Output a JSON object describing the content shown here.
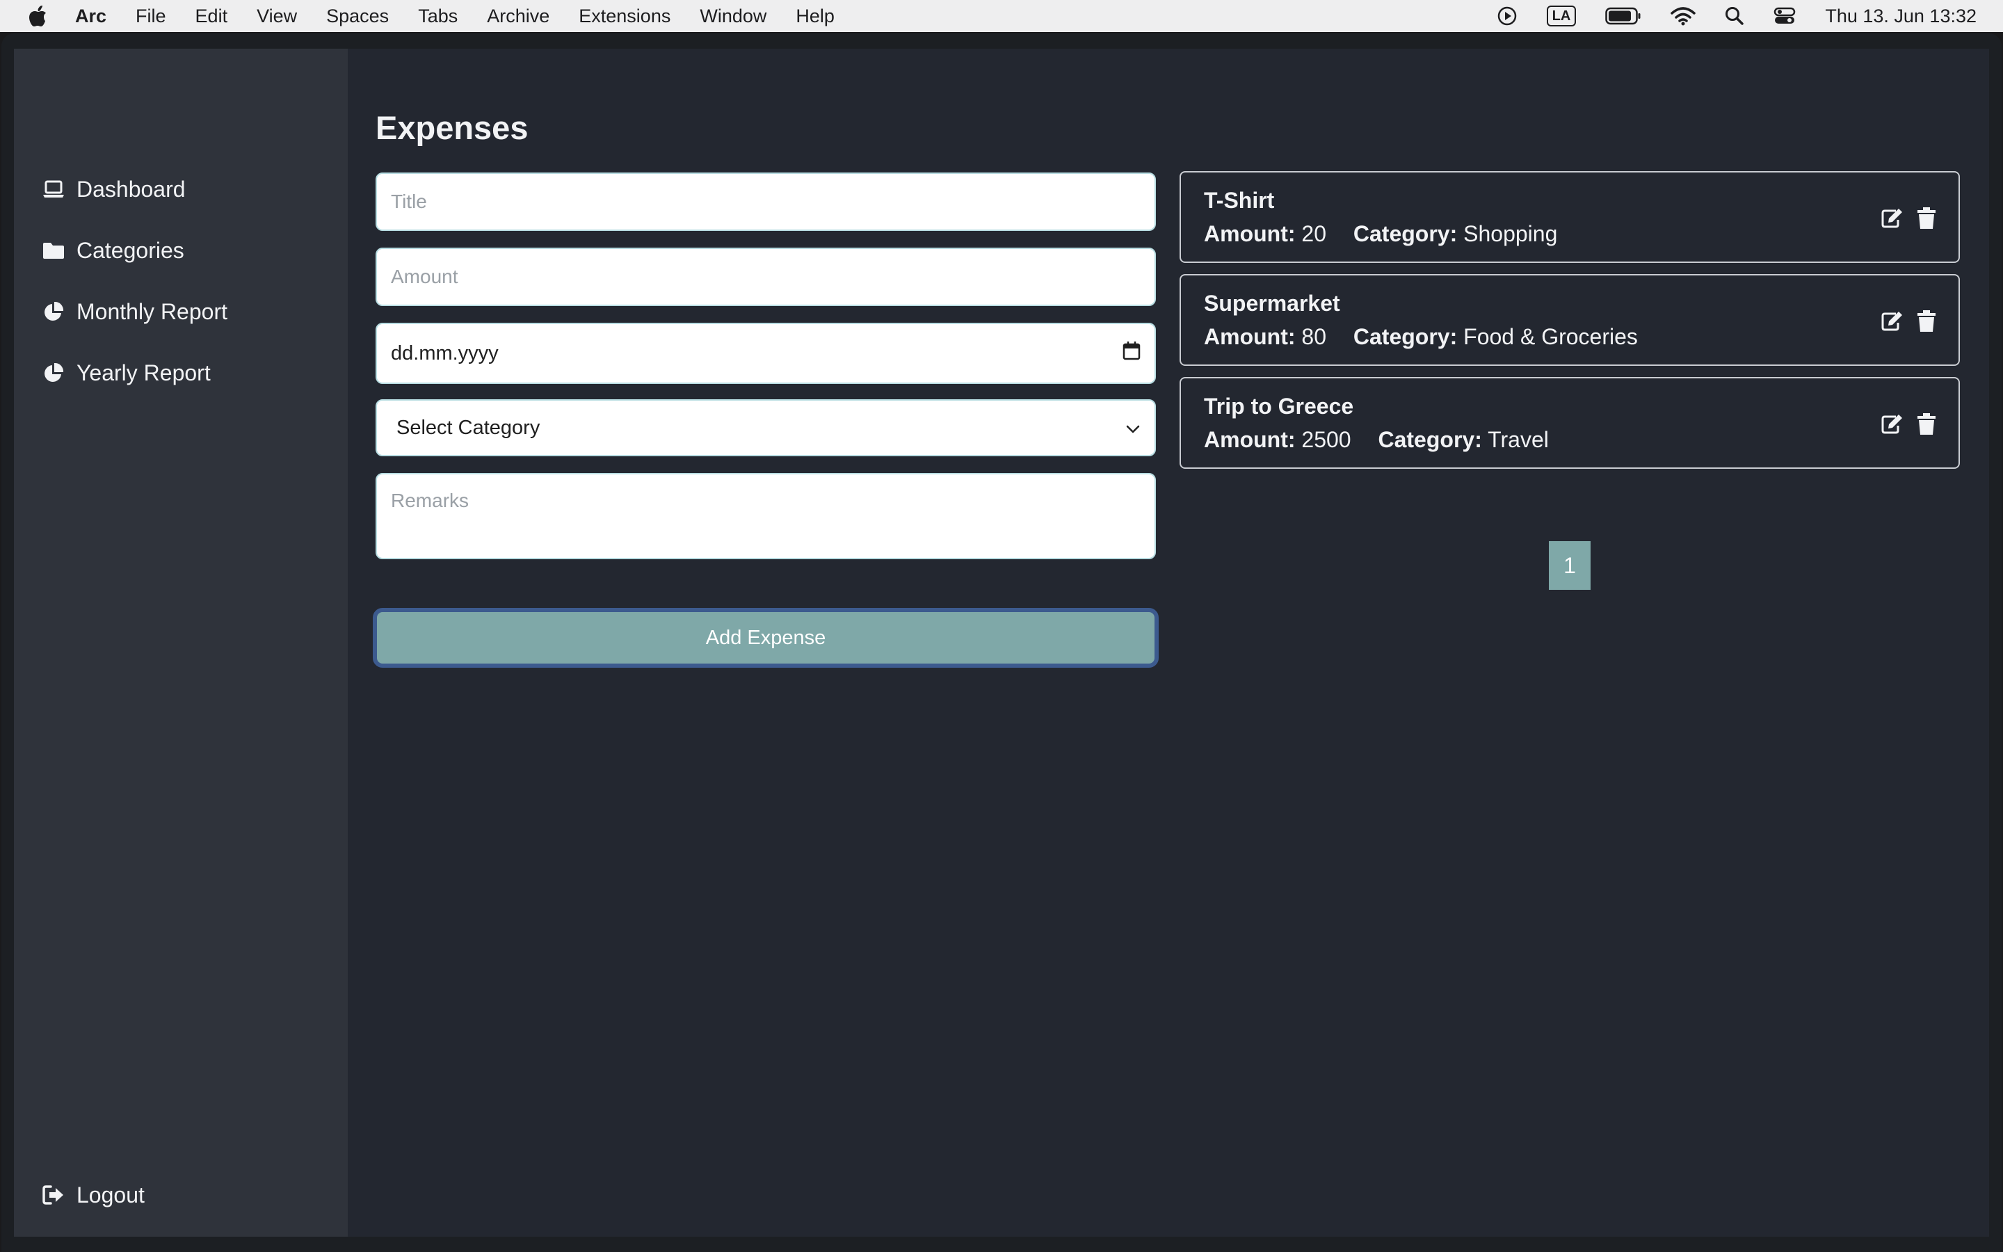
{
  "menubar": {
    "app_name": "Arc",
    "items": [
      "File",
      "Edit",
      "View",
      "Spaces",
      "Tabs",
      "Archive",
      "Extensions",
      "Window",
      "Help"
    ],
    "input_language": "LA",
    "clock": "Thu 13. Jun  13:32"
  },
  "sidebar": {
    "items": [
      {
        "label": "Dashboard",
        "icon": "laptop-icon"
      },
      {
        "label": "Categories",
        "icon": "folder-icon"
      },
      {
        "label": "Monthly Report",
        "icon": "pie-chart-icon"
      },
      {
        "label": "Yearly Report",
        "icon": "pie-chart-icon"
      }
    ],
    "logout_label": "Logout"
  },
  "main": {
    "title": "Expenses",
    "form": {
      "title_placeholder": "Title",
      "amount_placeholder": "Amount",
      "date_placeholder": "dd.mm.yyyy",
      "category_selected": "Select Category",
      "remarks_placeholder": "Remarks",
      "submit_label": "Add Expense"
    },
    "amount_label": "Amount:",
    "category_label": "Category:",
    "expenses": [
      {
        "title": "T-Shirt",
        "amount": "20",
        "category": "Shopping"
      },
      {
        "title": "Supermarket",
        "amount": "80",
        "category": "Food & Groceries"
      },
      {
        "title": "Trip to Greece",
        "amount": "2500",
        "category": "Travel"
      }
    ],
    "pagination": {
      "current_page": "1"
    }
  },
  "colors": {
    "sidebar_bg": "#2f333b",
    "content_bg": "#232730",
    "accent": "#7fa8a8",
    "focus_ring": "#3c5a8e"
  }
}
